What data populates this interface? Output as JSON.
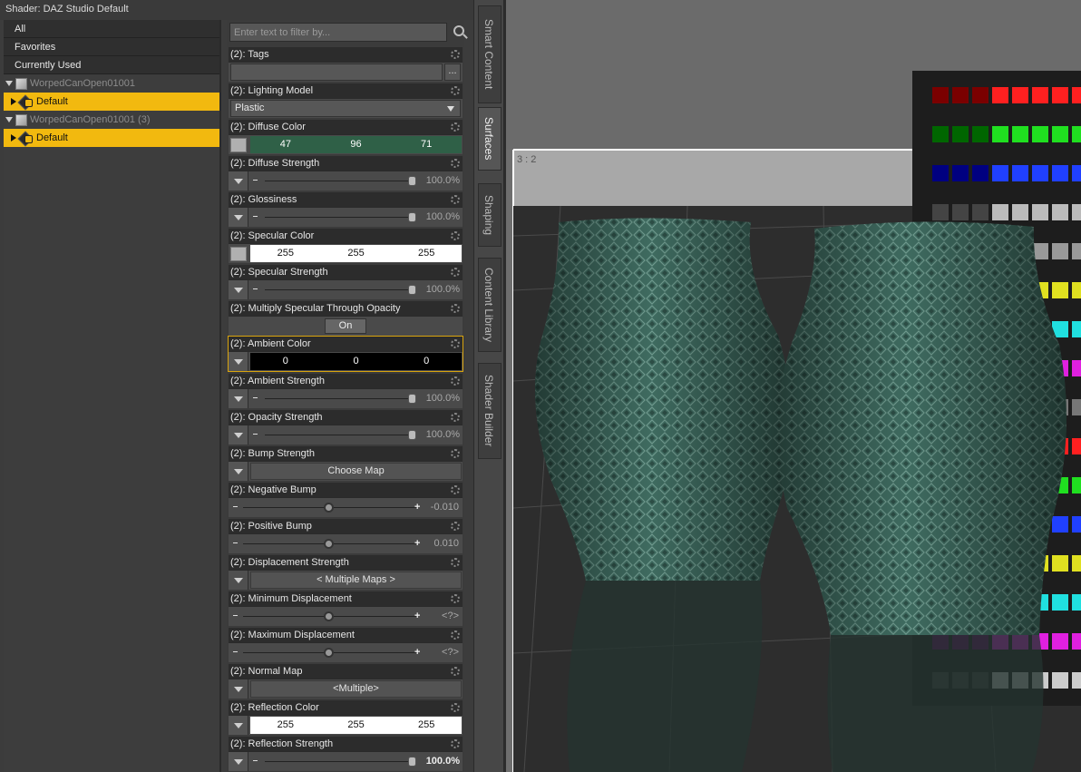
{
  "window": {
    "title": "Shader: DAZ Studio Default"
  },
  "tree": {
    "filters": [
      "All",
      "Favorites",
      "Currently Used"
    ],
    "groups": [
      {
        "name": "WorpedCanOpen01001",
        "item": "Default"
      },
      {
        "name": "WorpedCanOpen01001 (3)",
        "item": "Default"
      }
    ]
  },
  "filter": {
    "placeholder": "Enter text to filter by..."
  },
  "props": {
    "tags": {
      "label": "(2): Tags",
      "button": "..."
    },
    "lighting_model": {
      "label": "(2): Lighting Model",
      "value": "Plastic"
    },
    "diffuse_color": {
      "label": "(2): Diffuse Color",
      "r": "47",
      "g": "96",
      "b": "71",
      "bg": "#2f6047"
    },
    "diffuse_strength": {
      "label": "(2): Diffuse Strength",
      "value": "100.0%"
    },
    "glossiness": {
      "label": "(2): Glossiness",
      "value": "100.0%"
    },
    "specular_color": {
      "label": "(2): Specular Color",
      "r": "255",
      "g": "255",
      "b": "255",
      "bg": "#ffffff"
    },
    "specular_strength": {
      "label": "(2): Specular Strength",
      "value": "100.0%"
    },
    "multiply_specular": {
      "label": "(2): Multiply Specular Through Opacity",
      "value": "On"
    },
    "ambient_color": {
      "label": "(2): Ambient Color",
      "r": "0",
      "g": "0",
      "b": "0",
      "bg": "#000000"
    },
    "ambient_strength": {
      "label": "(2): Ambient Strength",
      "value": "100.0%"
    },
    "opacity_strength": {
      "label": "(2): Opacity Strength",
      "value": "100.0%"
    },
    "bump_strength": {
      "label": "(2): Bump Strength",
      "value": "Choose Map"
    },
    "negative_bump": {
      "label": "(2): Negative Bump",
      "value": "-0.010"
    },
    "positive_bump": {
      "label": "(2): Positive Bump",
      "value": "0.010"
    },
    "displacement_strength": {
      "label": "(2): Displacement Strength",
      "value": "< Multiple Maps >"
    },
    "min_displacement": {
      "label": "(2): Minimum Displacement",
      "value": "<?>"
    },
    "max_displacement": {
      "label": "(2): Maximum Displacement",
      "value": "<?>"
    },
    "normal_map": {
      "label": "(2): Normal Map",
      "value": "<Multiple>"
    },
    "reflection_color": {
      "label": "(2): Reflection Color",
      "r": "255",
      "g": "255",
      "b": "255",
      "bg": "#ffffff"
    },
    "reflection_strength": {
      "label": "(2): Reflection Strength",
      "value": "100.0%"
    }
  },
  "tabs": [
    "Smart Content",
    "Surfaces",
    "Shaping",
    "Content Library",
    "Shader Builder"
  ],
  "viewport": {
    "label": "3 : 2"
  },
  "colors": {
    "accent": "#f2b90f",
    "vase": "#3f6b60",
    "floor": "#2f2f2f"
  },
  "icons": {
    "search": "search-icon",
    "gear": "gear-icon",
    "figure": "cube-icon",
    "material": "material-icon"
  }
}
